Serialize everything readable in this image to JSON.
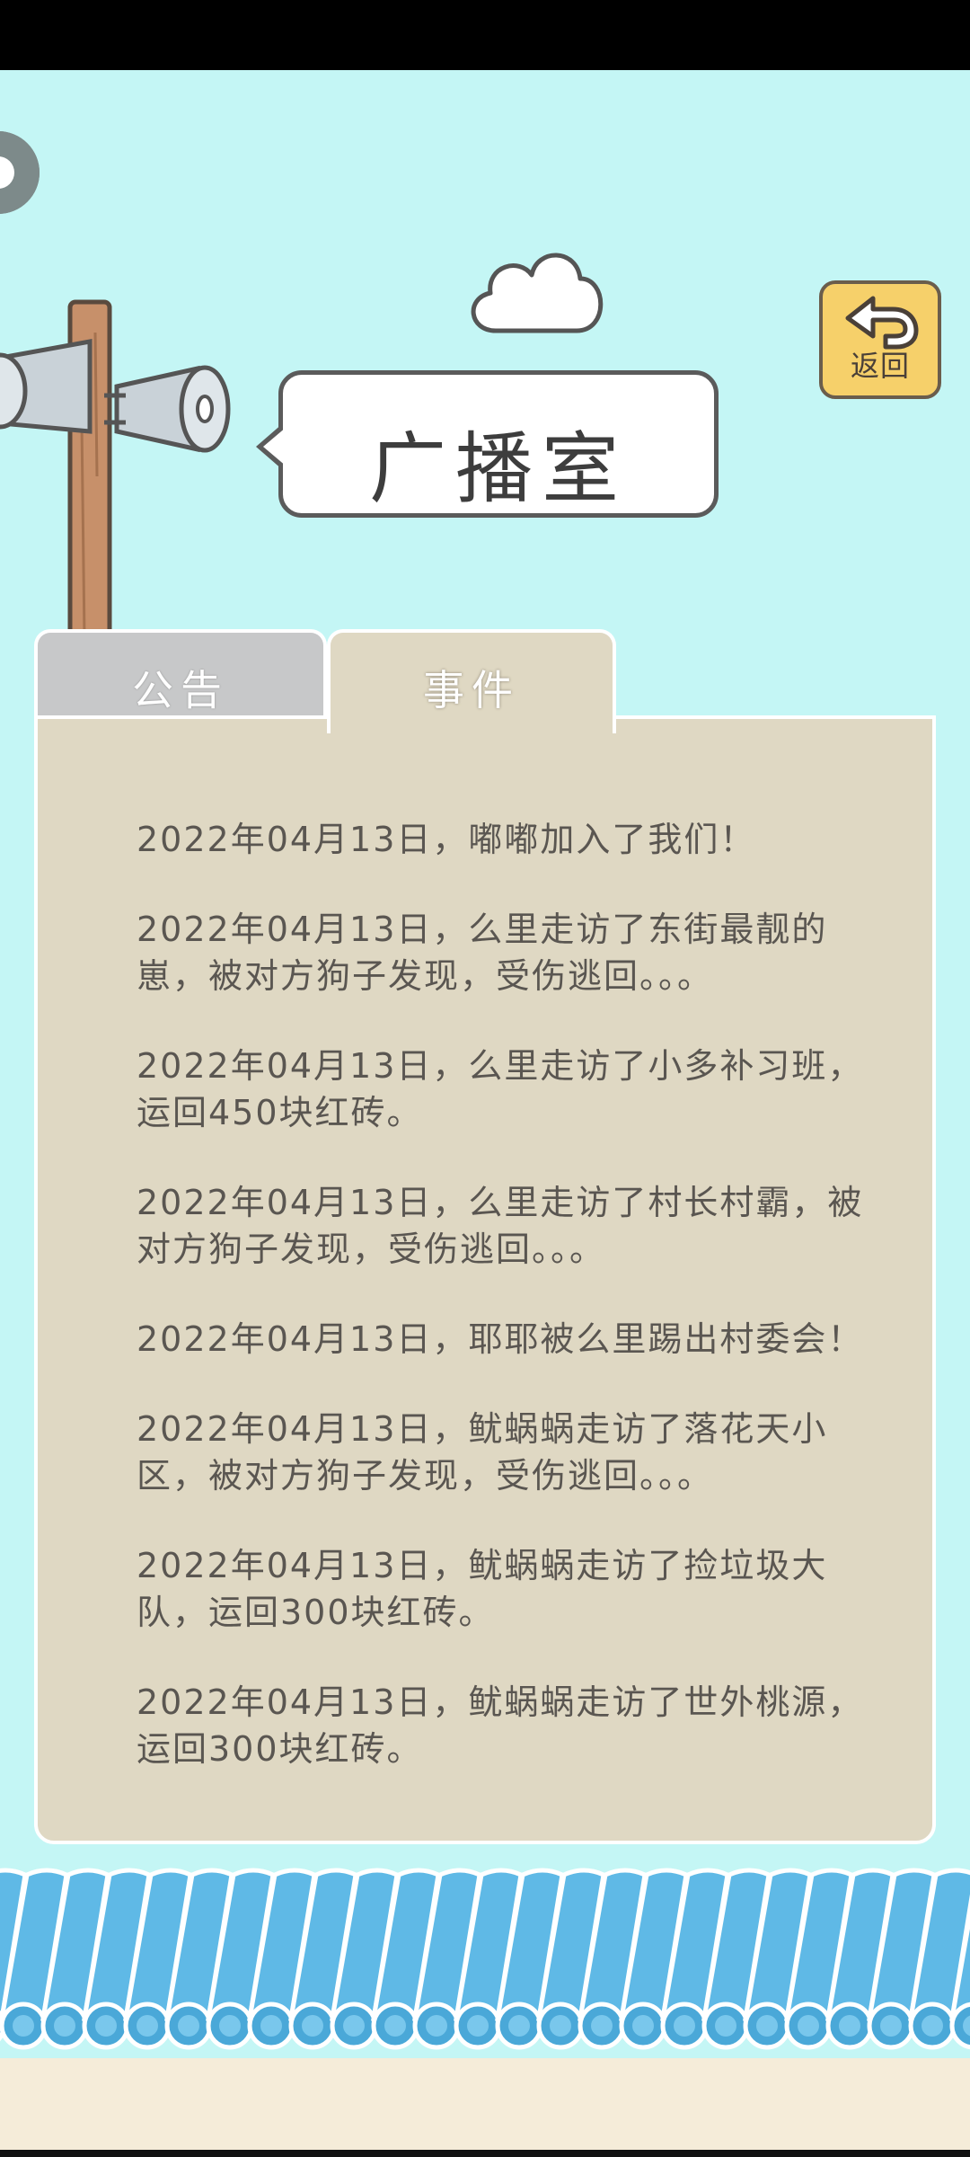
{
  "header": {
    "title": "广播室",
    "back_label": "返回"
  },
  "tabs": [
    {
      "label": "公告",
      "active": false
    },
    {
      "label": "事件",
      "active": true
    }
  ],
  "events": [
    "2022年04月13日，嘟嘟加入了我们！",
    "2022年04月13日，么里走访了东街最靓的崽，被对方狗子发现，受伤逃回。。。",
    "2022年04月13日，么里走访了小多补习班，运回450块红砖。",
    "2022年04月13日，么里走访了村长村霸，被对方狗子发现，受伤逃回。。。",
    "2022年04月13日，耶耶被么里踢出村委会！",
    "2022年04月13日，鱿蜗蜗走访了落花天小区，被对方狗子发现，受伤逃回。。。",
    "2022年04月13日，鱿蜗蜗走访了捡垃圾大队，运回300块红砖。",
    "2022年04月13日，鱿蜗蜗走访了世外桃源，运回300块红砖。"
  ],
  "colors": {
    "sky": "#c4f6f5",
    "panel": "#dfd8c3",
    "back_button": "#f6d06a",
    "roof_tile": "#5fb9e6"
  }
}
